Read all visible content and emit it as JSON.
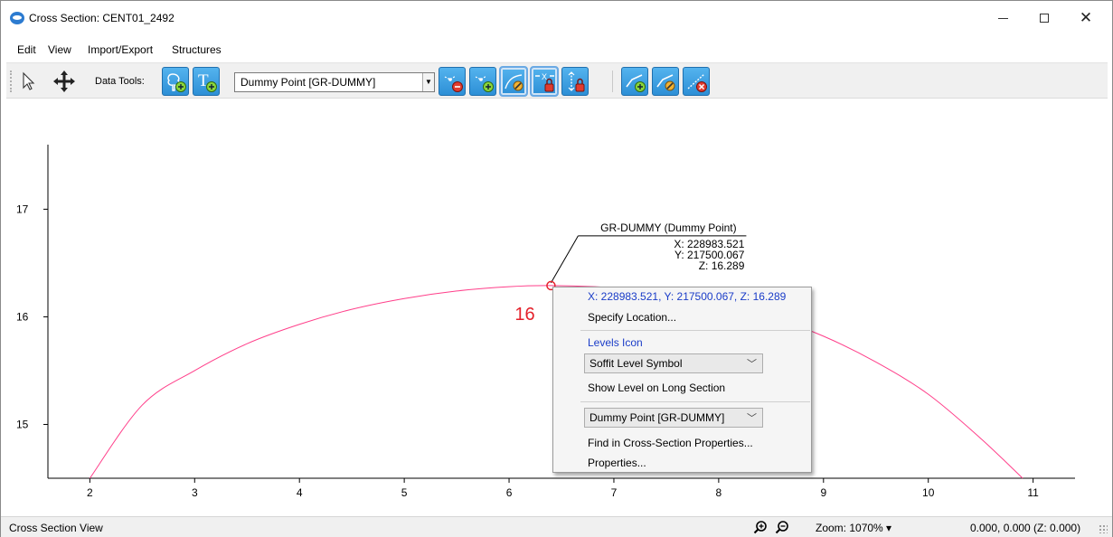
{
  "window": {
    "title": "Cross Section: CENT01_2492",
    "icon": "app-logo-icon"
  },
  "menu": {
    "items": [
      "Edit",
      "View",
      "Import/Export",
      "Structures"
    ]
  },
  "toolbar": {
    "data_tools_label": "Data Tools:",
    "point_type_value": "Dummy Point [GR-DUMMY]",
    "icons": [
      "select-arrow-icon",
      "pan-move-icon",
      "add-tree-point-icon",
      "add-text-icon",
      "delete-point-icon",
      "add-point-icon",
      "edit-point-icon",
      "lock-horizontal-icon",
      "lock-vertical-icon",
      "add-line-icon",
      "edit-line-icon",
      "delete-line-icon"
    ]
  },
  "chart_data": {
    "type": "line",
    "title": "",
    "xlabel": "",
    "ylabel": "",
    "xlim": [
      1.6,
      11.4
    ],
    "ylim": [
      14.5,
      17.6
    ],
    "x_ticks": [
      "2",
      "3",
      "4",
      "5",
      "6",
      "7",
      "8",
      "9",
      "10",
      "11"
    ],
    "y_ticks": [
      "15",
      "16",
      "17"
    ],
    "series": [
      {
        "color": "#ff3f8a",
        "x": [
          2.0,
          2.5,
          3.0,
          3.5,
          4.0,
          4.5,
          5.0,
          5.5,
          6.0,
          6.4,
          7.0,
          7.5,
          8.0,
          8.5,
          9.0,
          9.5,
          10.0,
          10.5,
          10.9
        ],
        "y": [
          14.5,
          15.18,
          15.5,
          15.75,
          15.93,
          16.07,
          16.17,
          16.24,
          16.28,
          16.29,
          16.27,
          16.22,
          16.13,
          16.0,
          15.82,
          15.58,
          15.28,
          14.87,
          14.5
        ]
      }
    ],
    "highlight_point": {
      "x": 6.4,
      "y": 16.29,
      "label": "16",
      "color": "#e4212b"
    },
    "annotation": {
      "title": "GR-DUMMY (Dummy Point)",
      "lines": [
        "X: 228983.521",
        "Y: 217500.067",
        "Z: 16.289"
      ]
    },
    "grid": false
  },
  "context_menu": {
    "coords": "X: 228983.521, Y: 217500.067, Z: 16.289",
    "specify_location": "Specify Location...",
    "levels_icon": "Levels Icon",
    "level_symbol": "Soffit Level Symbol",
    "show_level": "Show Level on Long Section",
    "point_type": "Dummy Point [GR-DUMMY]",
    "find_in_props": "Find in Cross-Section Properties...",
    "properties": "Properties..."
  },
  "status": {
    "view_name": "Cross Section View",
    "zoom": "Zoom: 1070% ▾",
    "coords": "0.000, 0.000 (Z: 0.000)"
  }
}
